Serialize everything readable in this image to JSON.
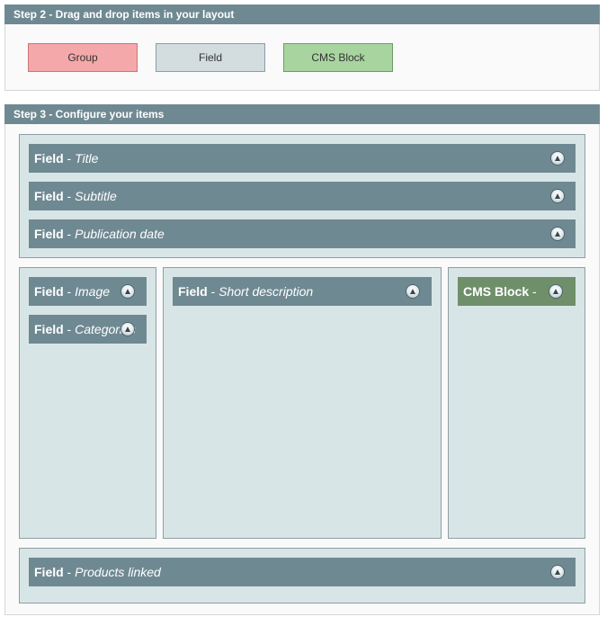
{
  "step2": {
    "title": "Step 2 - Drag and drop items in your layout",
    "palette": [
      {
        "label": "Group",
        "color": "#f5a8a9"
      },
      {
        "label": "Field",
        "color": "#d3dcdf"
      },
      {
        "label": "CMS Block",
        "color": "#a8d4a0"
      }
    ]
  },
  "step3": {
    "title": "Step 3 - Configure your items",
    "items": {
      "title": {
        "kind": "Field",
        "sep": " - ",
        "name": "Title"
      },
      "subtitle": {
        "kind": "Field",
        "sep": " - ",
        "name": "Subtitle"
      },
      "publication_date": {
        "kind": "Field",
        "sep": " - ",
        "name": "Publication date"
      },
      "image": {
        "kind": "Field",
        "sep": " - ",
        "name": "Image"
      },
      "categories": {
        "kind": "Field",
        "sep": " - ",
        "name": "Categories"
      },
      "short_description": {
        "kind": "Field",
        "sep": " - ",
        "name": "Short description"
      },
      "cms_block": {
        "kind": "CMS Block",
        "sep": " - ",
        "name": ""
      },
      "products_linked": {
        "kind": "Field",
        "sep": " - ",
        "name": "Products linked"
      }
    }
  },
  "icons": {
    "toggle": "collapse-toggle-icon"
  },
  "colors": {
    "header": "#6f8992",
    "field_bar": "#6f8992",
    "cms_bar": "#6e8f6a",
    "container": "#d8e5e6",
    "group": "#f5a8a9",
    "field": "#d3dcdf",
    "cms": "#a8d4a0"
  }
}
